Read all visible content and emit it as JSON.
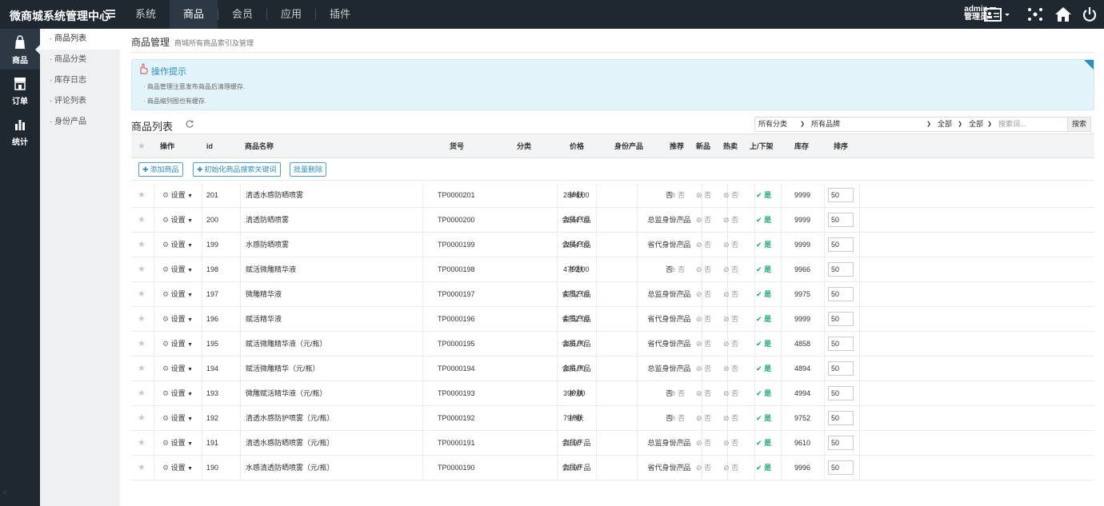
{
  "app": {
    "brand": "微商城系统管理中心"
  },
  "topnav": [
    "系统",
    "商品",
    "会员",
    "应用",
    "插件"
  ],
  "user": {
    "name": "admin",
    "role": "管理员"
  },
  "leftbar": [
    "商品",
    "订单",
    "统计"
  ],
  "subnav": [
    "商品列表",
    "商品分类",
    "库存日志",
    "评论列表",
    "身份产品"
  ],
  "page": {
    "title": "商品管理",
    "subtitle": "商城所有商品索引及管理"
  },
  "tips": {
    "title": "操作提示",
    "lines": [
      "商品管理注意发布商品后清理缓存.",
      "商品缩列图也有缓存."
    ]
  },
  "list": {
    "title": "商品列表"
  },
  "filters": {
    "category": "所有分类",
    "brand": "所有品牌",
    "f1": "全部",
    "f2": "全部",
    "search_placeholder": "搜索词...",
    "search_button": "搜索"
  },
  "columns": [
    "操作",
    "id",
    "商品名称",
    "货号",
    "分类",
    "价格",
    "身份产品",
    "推荐",
    "新品",
    "热卖",
    "上/下架",
    "库存",
    "排序"
  ],
  "actions": {
    "add": "添加商品",
    "init": "初始化商品搜索关键词",
    "batch_delete": "批量删除"
  },
  "labels": {
    "settings": "设置",
    "no": "否",
    "yes": "是"
  },
  "rows": [
    {
      "id": "201",
      "name": "清透水感防晒喷雾",
      "sku": "TP0000201",
      "cat": "护肤",
      "price": "2844.00",
      "identity": "否",
      "stock": "9999",
      "sort": "50"
    },
    {
      "id": "200",
      "name": "清透防晒喷雾",
      "sku": "TP0000200",
      "cat": "会员产品",
      "price": "2844.00",
      "identity": "总监身份产品",
      "stock": "9999",
      "sort": "50"
    },
    {
      "id": "199",
      "name": "水感防晒喷雾",
      "sku": "TP0000199",
      "cat": "会员产品",
      "price": "2844.00",
      "identity": "省代身份产品",
      "stock": "9999",
      "sort": "50"
    },
    {
      "id": "198",
      "name": "赋活微雕精华液",
      "sku": "TP0000198",
      "cat": "护肤",
      "price": "4752.00",
      "identity": "否",
      "stock": "9966",
      "sort": "50"
    },
    {
      "id": "197",
      "name": "微雕精华液",
      "sku": "TP0000197",
      "cat": "会员产品",
      "price": "4752.00",
      "identity": "总监身份产品",
      "stock": "9975",
      "sort": "50"
    },
    {
      "id": "196",
      "name": "赋活精华液",
      "sku": "TP0000196",
      "cat": "会员产品",
      "price": "4752.00",
      "identity": "省代身份产品",
      "stock": "9999",
      "sort": "50"
    },
    {
      "id": "195",
      "name": "赋活微雕精华液（元/瓶）",
      "sku": "TP0000195",
      "cat": "会员产品",
      "price": "396.00",
      "identity": "省代身份产品",
      "stock": "4858",
      "sort": "50"
    },
    {
      "id": "194",
      "name": "赋活微雕精华（元/瓶）",
      "sku": "TP0000194",
      "cat": "会员产品",
      "price": "396.00",
      "identity": "总监身份产品",
      "stock": "4894",
      "sort": "50"
    },
    {
      "id": "193",
      "name": "微雕赋活精华液（元/瓶）",
      "sku": "TP0000193",
      "cat": "护肤",
      "price": "396.00",
      "identity": "否",
      "stock": "4994",
      "sort": "50"
    },
    {
      "id": "192",
      "name": "清透水感防护喷雾（元/瓶）",
      "sku": "TP0000192",
      "cat": "护肤",
      "price": "79.00",
      "identity": "否",
      "stock": "9752",
      "sort": "50"
    },
    {
      "id": "191",
      "name": "清透水感防晒喷雾（元/瓶）",
      "sku": "TP0000191",
      "cat": "会员产品",
      "price": "79.00",
      "identity": "总监身份产品",
      "stock": "9610",
      "sort": "50"
    },
    {
      "id": "190",
      "name": "水感清透防晒喷雾（元/瓶）",
      "sku": "TP0000190",
      "cat": "会员产品",
      "price": "79.00",
      "identity": "省代身份产品",
      "stock": "9996",
      "sort": "50"
    }
  ]
}
